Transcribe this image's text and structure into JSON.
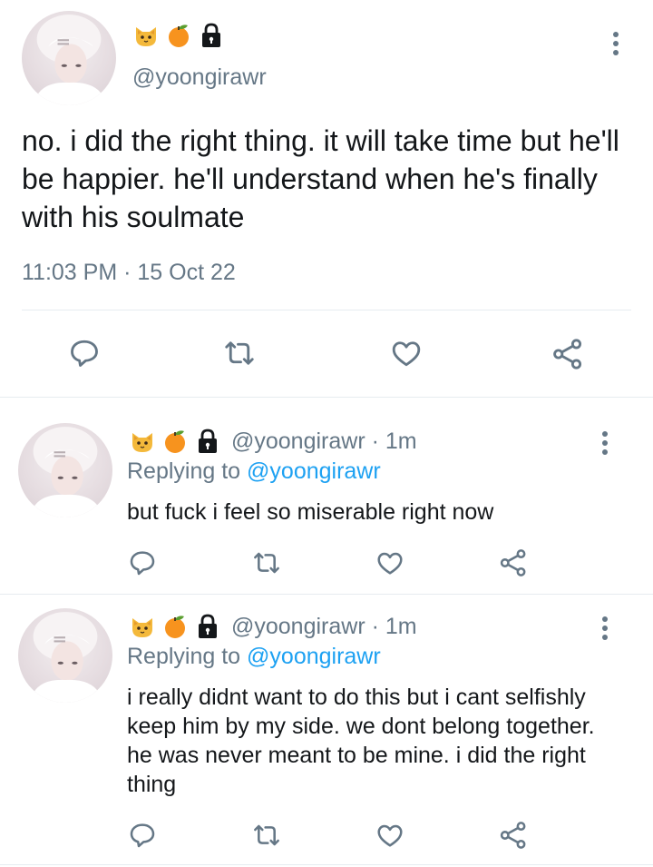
{
  "main_tweet": {
    "handle": "@yoongirawr",
    "badges": [
      "cat-face-icon",
      "tangerine-icon",
      "lock-icon"
    ],
    "text": "no. i did the right thing. it will take time but he'll be happier. he'll understand when he's finally with his soulmate",
    "timestamp": "11:03 PM · 15 Oct 22",
    "actions": [
      "reply-icon",
      "retweet-icon",
      "like-icon",
      "share-icon"
    ]
  },
  "replies": [
    {
      "handle": "@yoongirawr",
      "time": "· 1m",
      "replying_label": "Replying to",
      "replying_handle": "@yoongirawr",
      "text": "but fuck i feel so miserable right now"
    },
    {
      "handle": "@yoongirawr",
      "time": "· 1m",
      "replying_label": "Replying to",
      "replying_handle": "@yoongirawr",
      "text": "i really didnt want to do this but i cant selfishly keep him by my side. we dont belong together. he was never meant to be mine. i did the right thing"
    }
  ],
  "colors": {
    "text": "#14171a",
    "secondary": "#657786",
    "link": "#1da1f2",
    "divider": "#e6ecf0"
  }
}
